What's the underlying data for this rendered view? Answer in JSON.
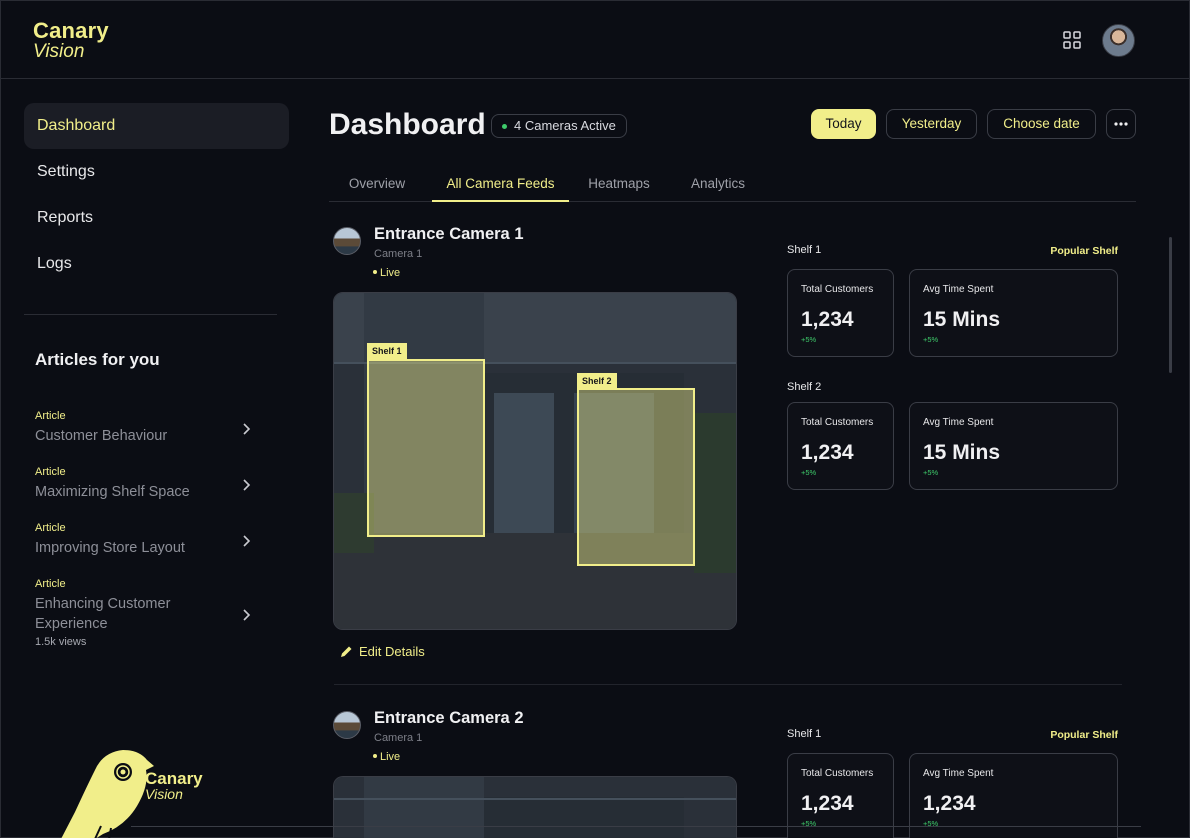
{
  "brand": {
    "line1": "Canary",
    "line2": "Vision"
  },
  "sidebar": {
    "items": [
      {
        "label": "Dashboard",
        "active": true
      },
      {
        "label": "Settings"
      },
      {
        "label": "Reports"
      },
      {
        "label": "Logs"
      }
    ],
    "articles_title": "Articles for you",
    "articles": [
      {
        "tag": "Article",
        "title": "Customer Behaviour"
      },
      {
        "tag": "Article",
        "title": "Maximizing Shelf Space"
      },
      {
        "tag": "Article",
        "title": "Improving Store Layout"
      },
      {
        "tag": "Article",
        "title": "Enhancing Customer Experience",
        "views": "1.5k views"
      }
    ],
    "footer_logo": {
      "line1": "Canary",
      "line2": "Vision"
    }
  },
  "header": {
    "title": "Dashboard",
    "cameras_active": "4 Cameras Active",
    "filters": [
      "Today",
      "Yesterday",
      "Choose date"
    ],
    "more_icon": "more-horizontal-icon"
  },
  "tabs": [
    "Overview",
    "All Camera Feeds",
    "Heatmaps",
    "Analytics"
  ],
  "active_tab": "All Camera Feeds",
  "cameras": [
    {
      "name": "Entrance Camera 1",
      "sub": "Camera 1",
      "status": "Live",
      "shelf_tags": [
        "Shelf 1",
        "Shelf 2"
      ],
      "edit_label": "Edit Details",
      "popular_label": "Popular Shelf",
      "shelves": [
        {
          "label": "Shelf 1",
          "stats": [
            {
              "label": "Total Customers",
              "value": "1,234",
              "delta": "+5%"
            },
            {
              "label": "Avg Time Spent",
              "value": "15 Mins",
              "delta": "+5%"
            }
          ]
        },
        {
          "label": "Shelf 2",
          "stats": [
            {
              "label": "Total Customers",
              "value": "1,234",
              "delta": "+5%"
            },
            {
              "label": "Avg Time Spent",
              "value": "15 Mins",
              "delta": "+5%"
            }
          ]
        }
      ]
    },
    {
      "name": "Entrance Camera 2",
      "sub": "Camera 1",
      "status": "Live",
      "popular_label": "Popular Shelf",
      "shelves": [
        {
          "label": "Shelf 1",
          "stats": [
            {
              "label": "Total Customers",
              "value": "1,234",
              "delta": "+5%"
            },
            {
              "label": "Avg Time Spent",
              "value": "1,234",
              "delta": "+5%"
            }
          ]
        }
      ]
    }
  ],
  "colors": {
    "accent": "#f1ee8a",
    "background": "#0b0d14",
    "positive": "#3ecb6b"
  }
}
